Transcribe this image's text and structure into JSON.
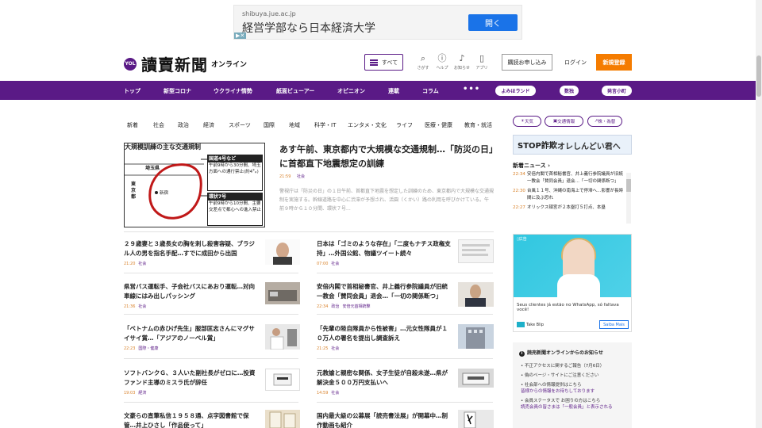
{
  "top_ad": {
    "domain": "shibuya.jue.ac.jp",
    "headline": "経営学部なら日本経済大学",
    "button": "開く"
  },
  "header": {
    "logo_badge": "YOL",
    "logo_name": "讀賣新聞",
    "logo_sub": "オンライン",
    "menu_label": "すべて",
    "icons": [
      {
        "label": "さがす",
        "icon": "search-icon"
      },
      {
        "label": "ヘルプ",
        "icon": "help-icon"
      },
      {
        "label": "お知らせ",
        "icon": "bell-icon"
      },
      {
        "label": "アプリ",
        "icon": "phone-icon"
      }
    ],
    "subscribe_label": "購読お申し込み",
    "login_label": "ログイン",
    "register_label": "新規登録"
  },
  "nav": {
    "items": [
      "トップ",
      "新型コロナ",
      "ウクライナ情勢",
      "紙面ビューアー",
      "オピニオン",
      "連載",
      "コラム"
    ],
    "more": "•••",
    "pills": [
      "よみほランド",
      "数独",
      "発言小町"
    ]
  },
  "subnav": [
    "新着",
    "社会",
    "政治",
    "経済",
    "スポーツ",
    "国際",
    "地域",
    "科学・IT",
    "エンタメ・文化",
    "ライフ",
    "医療・健康",
    "教育・就活"
  ],
  "featured": {
    "map": {
      "caption": "大規模訓練の主な交通規制",
      "pref": "埼玉県",
      "tokyo": "東京都",
      "station": "新宿",
      "box1_title": "国道4号など",
      "box1_text": "午前9時から30分間、埼玉方面への通行禁止(約4㌔)",
      "box2_title": "環状7号",
      "box2_text": "午前9時から10分間、主要交差点で都心への進入禁止"
    },
    "title": "あす午前、東京都内で大規模な交通規制…「防災の日」に首都直下地震想定の訓練",
    "time": "21:59",
    "category": "社会",
    "body": "警視庁は「防災の日」の１日午前、首都直下地震を想定した訓練のため、東京都内で大規模な交通規制を実施する。幹線道路を中心に渋滞が予想され、活園（くかい）路の利用を呼びかけている。午前９時から１０分間、環状７号..."
  },
  "articles_left": [
    {
      "title": "２９歳妻と３歳長女の胸を刺し殺害容疑、ブラジル人の男を指名手配…すでに成田から出国",
      "time": "21:20",
      "category": "社会",
      "extra": ""
    },
    {
      "title": "県営バス運転手、子会社バスにあおり運転…対向車線にはみ出しパッシング",
      "time": "21:36",
      "category": "社会",
      "extra": ""
    },
    {
      "title": "「ベトナムの赤ひげ先生」服部匡志さんにマグサイサイ賞…「アジアのノーベル賞」",
      "time": "22:23",
      "category": "国際・健康",
      "extra": ""
    },
    {
      "title": "ソフトバンクＧ、３人いた副社長がゼロに…投資ファンド主導のミスラ氏が辞任",
      "time": "19:03",
      "category": "経済",
      "extra": ""
    },
    {
      "title": "文豪らの直筆私信１９５８通、点字図書館で保管…井上ひさし「作品使って」",
      "time": "",
      "category": "",
      "extra": ""
    }
  ],
  "articles_right": [
    {
      "title": "日本は「ゴミのような存在」「二度もナチス政権支持」…外国公館、物議ツイート続々",
      "time": "07:00",
      "category": "社会",
      "extra": ""
    },
    {
      "title": "安倍内閣で首相秘書官、井上義行参院議員が旧統一教会「賛同会員」退会…「一切の関係断つ」",
      "time": "22:34",
      "category": "政治",
      "extra": "安倍元首相銃撃"
    },
    {
      "title": "「先輩の陸自隊員から性被害」…元女性隊員が１０万人の署名を提出し調査訴え",
      "time": "21:25",
      "category": "社会",
      "extra": ""
    },
    {
      "title": "元教諭と親密な関係、女子生徒が自殺未遂…県が解決金５００万円支払いへ",
      "time": "14:59",
      "category": "社会",
      "extra": ""
    },
    {
      "title": "国内最大級の公募展「読売書法展」が開幕中…制作動画も紹介",
      "time": "",
      "category": "",
      "extra": ""
    }
  ],
  "right": {
    "pills": [
      "天気",
      "交通情報",
      "株・為替"
    ],
    "banner_a": "STOP詐欺",
    "banner_b": "オレしんどい君へ",
    "latest_heading": "新着ニュース",
    "latest": [
      {
        "time": "22:34",
        "text": "安倍内閣で首相秘書官、井上義行参院議員が旧統一教会「賛同会員」退会…「一切の関係断つ」"
      },
      {
        "time": "22:30",
        "text": "台風１１号、沖縄の南海上で停滞へ…影響が長時間に及ぶ恐れ"
      },
      {
        "time": "22:27",
        "text": "オリックス頓宮が２本塁打５打点、本塁"
      }
    ],
    "ad": {
      "message": "Seus clientes já estão no WhatsApp, só faltava você!",
      "brand": "Take Blip",
      "more": "Saiba Mais"
    },
    "notice": {
      "heading": "読売新聞オンラインからのお知らせ",
      "items": [
        {
          "text": "不正アクセスに関するご報告（7月6日）",
          "sub": ""
        },
        {
          "text": "偽のページ・サイトにご注意ください",
          "sub": ""
        },
        {
          "text": "社会部への情報提供はこちら",
          "sub": "皆様からの情報をお待ちしております"
        },
        {
          "text": "会員ステータスで お困りの方はこちら",
          "sub": "読売会員の皆さまは「一般会員」と表示される"
        }
      ]
    }
  }
}
